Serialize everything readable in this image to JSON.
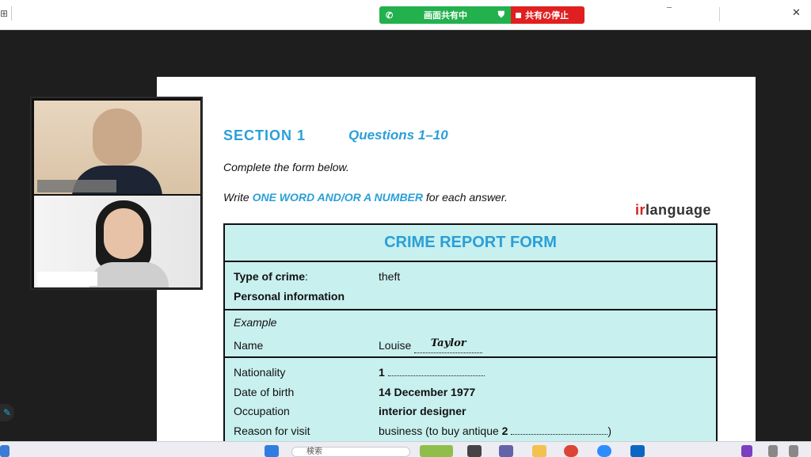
{
  "share_bar": {
    "sharing_label": "画面共有中",
    "stop_label": "共有の停止"
  },
  "window": {
    "close_glyph": "✕"
  },
  "document": {
    "section": "SECTION 1",
    "questions": "Questions 1–10",
    "instruction_1": "Complete the form below.",
    "instruction_2_pre": "Write ",
    "instruction_2_highlight": "ONE WORD AND/OR A NUMBER",
    "instruction_2_post": " for each answer.",
    "logo_ir": "ir",
    "logo_rest": "language",
    "form": {
      "title": "CRIME REPORT FORM",
      "type_of_crime_label": "Type of crime",
      "type_of_crime_colon": ":",
      "type_of_crime_value": "theft",
      "personal_info_label": "Personal information",
      "example_label": "Example",
      "name_label": "Name",
      "name_value_prefix": "Louise",
      "name_value_handwritten": "Taylor",
      "nationality_label": "Nationality",
      "nationality_value": "1",
      "dob_label": "Date of birth",
      "dob_value": "14 December 1977",
      "occupation_label": "Occupation",
      "occupation_value": "interior designer",
      "reason_label": "Reason for visit",
      "reason_value_pre": "business (to buy antique ",
      "reason_value_num": "2",
      "reason_value_post": ")"
    }
  },
  "taskbar": {
    "search_placeholder": "検索"
  },
  "colors": {
    "accent_blue": "#2a9fd8",
    "form_bg": "#c8f0ee",
    "share_green": "#22b14c",
    "share_red": "#e02020"
  }
}
